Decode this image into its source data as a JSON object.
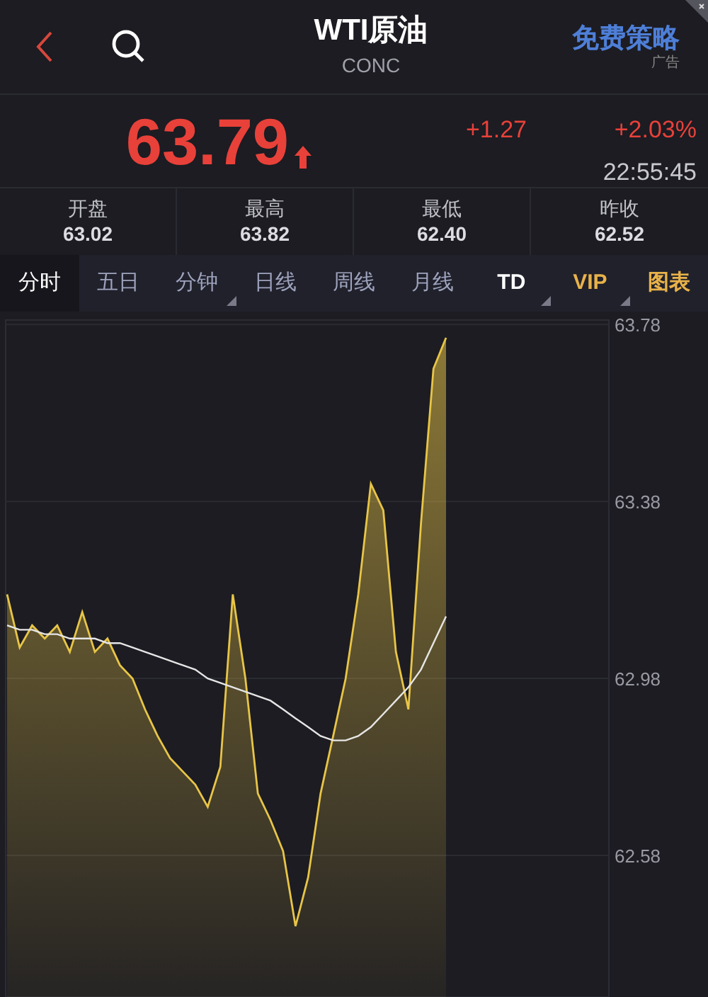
{
  "header": {
    "title": "WTI原油",
    "subtitle": "CONC",
    "ad": {
      "label": "免费策略",
      "tag": "广告"
    }
  },
  "quote": {
    "price": "63.79",
    "rising": true,
    "change": "+1.27",
    "change_pct": "+2.03%",
    "time": "22:55:45"
  },
  "stats": [
    {
      "label": "开盘",
      "value": "63.02"
    },
    {
      "label": "最高",
      "value": "63.82"
    },
    {
      "label": "最低",
      "value": "62.40"
    },
    {
      "label": "昨收",
      "value": "62.52"
    }
  ],
  "tabs": [
    {
      "label": "分时",
      "selected": true,
      "dropdown": false,
      "kind": "plain"
    },
    {
      "label": "五日",
      "selected": false,
      "dropdown": false,
      "kind": "plain"
    },
    {
      "label": "分钟",
      "selected": false,
      "dropdown": true,
      "kind": "plain"
    },
    {
      "label": "日线",
      "selected": false,
      "dropdown": false,
      "kind": "plain"
    },
    {
      "label": "周线",
      "selected": false,
      "dropdown": false,
      "kind": "plain"
    },
    {
      "label": "月线",
      "selected": false,
      "dropdown": false,
      "kind": "plain"
    },
    {
      "label": "TD",
      "selected": false,
      "dropdown": true,
      "kind": "bold"
    },
    {
      "label": "VIP",
      "selected": false,
      "dropdown": true,
      "kind": "gold"
    },
    {
      "label": "图表",
      "selected": false,
      "dropdown": false,
      "kind": "gold"
    }
  ],
  "chart": {
    "chart_data": {
      "type": "area",
      "grid": true,
      "ylim": [
        62.26,
        63.79
      ],
      "yticks": [
        62.58,
        62.98,
        63.38,
        63.78
      ],
      "series": [
        {
          "type": "area",
          "color": "#e8c547",
          "values": [
            63.17,
            63.05,
            63.1,
            63.07,
            63.1,
            63.04,
            63.13,
            63.04,
            63.07,
            63.01,
            62.98,
            62.91,
            62.85,
            62.8,
            62.77,
            62.74,
            62.69,
            62.78,
            63.17,
            62.98,
            62.72,
            62.66,
            62.59,
            62.42,
            62.53,
            62.72,
            62.85,
            62.98,
            63.17,
            63.42,
            63.36,
            63.04,
            62.91,
            63.33,
            63.68,
            63.75
          ]
        },
        {
          "type": "line",
          "color": "#e6e6e6",
          "values": [
            63.1,
            63.09,
            63.09,
            63.08,
            63.08,
            63.07,
            63.07,
            63.07,
            63.06,
            63.06,
            63.05,
            63.04,
            63.03,
            63.02,
            63.01,
            63.0,
            62.98,
            62.97,
            62.96,
            62.95,
            62.94,
            62.93,
            62.91,
            62.89,
            62.87,
            62.85,
            62.84,
            62.84,
            62.85,
            62.87,
            62.9,
            62.93,
            62.96,
            63.0,
            63.06,
            63.12
          ]
        }
      ]
    }
  }
}
